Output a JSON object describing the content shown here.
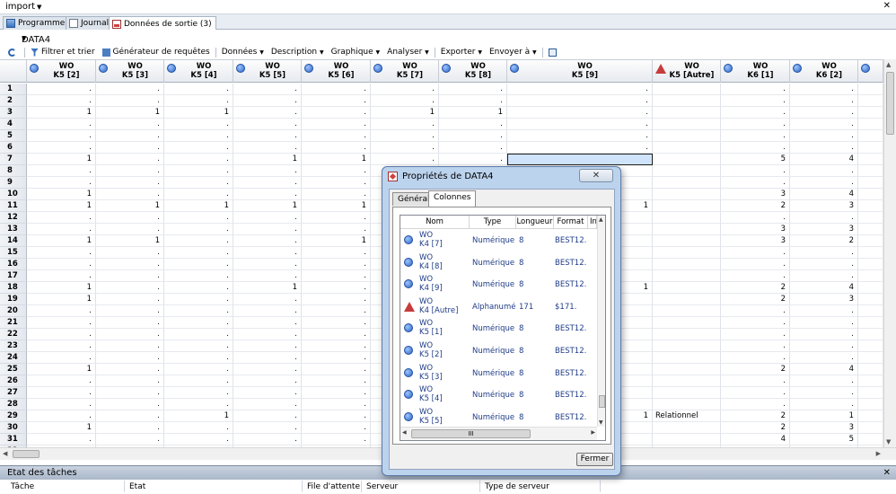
{
  "window": {
    "title": "import"
  },
  "tabs": [
    {
      "label": "Programme"
    },
    {
      "label": "Journal"
    },
    {
      "label": "Données de sortie (3)"
    }
  ],
  "dataset": {
    "name": "DATA4"
  },
  "toolbar": {
    "filter": "Filtrer et trier",
    "query": "Générateur de requêtes",
    "data": "Données",
    "description": "Description",
    "graph": "Graphique",
    "analyze": "Analyser",
    "export": "Exporter",
    "send": "Envoyer à"
  },
  "grid": {
    "columns": [
      {
        "l1": "WO",
        "l2": "K5 [2]",
        "type": "num"
      },
      {
        "l1": "WO",
        "l2": "K5 [3]",
        "type": "num"
      },
      {
        "l1": "WO",
        "l2": "K5 [4]",
        "type": "num"
      },
      {
        "l1": "WO",
        "l2": "K5 [5]",
        "type": "num"
      },
      {
        "l1": "WO",
        "l2": "K5 [6]",
        "type": "num"
      },
      {
        "l1": "WO",
        "l2": "K5 [7]",
        "type": "num"
      },
      {
        "l1": "WO",
        "l2": "K5 [8]",
        "type": "num"
      },
      {
        "l1": "WO",
        "l2": "K5 [9]",
        "type": "num"
      },
      {
        "l1": "WO",
        "l2": "K5 [Autre]",
        "type": "char"
      },
      {
        "l1": "WO",
        "l2": "K6 [1]",
        "type": "num"
      },
      {
        "l1": "WO",
        "l2": "K6 [2]",
        "type": "num"
      },
      {
        "l1": "",
        "l2": "",
        "type": "num"
      }
    ],
    "rows": [
      {
        "n": "1",
        "v": [
          ".",
          ".",
          ".",
          ".",
          ".",
          ".",
          ".",
          ".",
          "",
          ".",
          ".",
          ""
        ]
      },
      {
        "n": "2",
        "v": [
          ".",
          ".",
          ".",
          ".",
          ".",
          ".",
          ".",
          ".",
          "",
          ".",
          ".",
          ""
        ]
      },
      {
        "n": "3",
        "v": [
          "1",
          "1",
          "1",
          ".",
          ".",
          "1",
          "1",
          ".",
          "",
          ".",
          ".",
          ""
        ]
      },
      {
        "n": "4",
        "v": [
          ".",
          ".",
          ".",
          ".",
          ".",
          ".",
          ".",
          ".",
          "",
          ".",
          ".",
          ""
        ]
      },
      {
        "n": "5",
        "v": [
          ".",
          ".",
          ".",
          ".",
          ".",
          ".",
          ".",
          ".",
          "",
          ".",
          ".",
          ""
        ]
      },
      {
        "n": "6",
        "v": [
          ".",
          ".",
          ".",
          ".",
          ".",
          ".",
          ".",
          ".",
          "",
          ".",
          ".",
          ""
        ]
      },
      {
        "n": "7",
        "v": [
          "1",
          ".",
          ".",
          "1",
          "1",
          ".",
          ".",
          "",
          "",
          "5",
          "4",
          ""
        ]
      },
      {
        "n": "8",
        "v": [
          ".",
          ".",
          ".",
          ".",
          ".",
          "",
          "",
          "",
          "",
          ".",
          ".",
          ""
        ]
      },
      {
        "n": "9",
        "v": [
          ".",
          ".",
          ".",
          ".",
          ".",
          "",
          "",
          "",
          "",
          ".",
          ".",
          ""
        ]
      },
      {
        "n": "10",
        "v": [
          "1",
          ".",
          ".",
          ".",
          ".",
          "",
          "",
          "",
          "",
          "3",
          "4",
          ""
        ]
      },
      {
        "n": "11",
        "v": [
          "1",
          "1",
          "1",
          "1",
          "1",
          "",
          "",
          "1",
          "",
          "2",
          "3",
          ""
        ]
      },
      {
        "n": "12",
        "v": [
          ".",
          ".",
          ".",
          ".",
          ".",
          "",
          "",
          "",
          "",
          ".",
          ".",
          ""
        ]
      },
      {
        "n": "13",
        "v": [
          ".",
          ".",
          ".",
          ".",
          ".",
          "",
          "",
          "",
          "",
          "3",
          "3",
          ""
        ]
      },
      {
        "n": "14",
        "v": [
          "1",
          "1",
          ".",
          ".",
          "1",
          "",
          "",
          "",
          "",
          "3",
          "2",
          ""
        ]
      },
      {
        "n": "15",
        "v": [
          ".",
          ".",
          ".",
          ".",
          ".",
          "",
          "",
          "",
          "",
          ".",
          ".",
          ""
        ]
      },
      {
        "n": "16",
        "v": [
          ".",
          ".",
          ".",
          ".",
          ".",
          "",
          "",
          "",
          "",
          ".",
          ".",
          ""
        ]
      },
      {
        "n": "17",
        "v": [
          ".",
          ".",
          ".",
          ".",
          ".",
          "",
          "",
          "",
          "",
          ".",
          ".",
          ""
        ]
      },
      {
        "n": "18",
        "v": [
          "1",
          ".",
          ".",
          "1",
          ".",
          "",
          "",
          "1",
          "",
          "2",
          "4",
          ""
        ]
      },
      {
        "n": "19",
        "v": [
          "1",
          ".",
          ".",
          ".",
          ".",
          "",
          "",
          "",
          "",
          "2",
          "3",
          ""
        ]
      },
      {
        "n": "20",
        "v": [
          ".",
          ".",
          ".",
          ".",
          ".",
          "",
          "",
          "",
          "",
          ".",
          ".",
          ""
        ]
      },
      {
        "n": "21",
        "v": [
          ".",
          ".",
          ".",
          ".",
          ".",
          "",
          "",
          "",
          "",
          ".",
          ".",
          ""
        ]
      },
      {
        "n": "22",
        "v": [
          ".",
          ".",
          ".",
          ".",
          ".",
          "",
          "",
          "",
          "",
          ".",
          ".",
          ""
        ]
      },
      {
        "n": "23",
        "v": [
          ".",
          ".",
          ".",
          ".",
          ".",
          "",
          "",
          "",
          "",
          ".",
          ".",
          ""
        ]
      },
      {
        "n": "24",
        "v": [
          ".",
          ".",
          ".",
          ".",
          ".",
          "",
          "",
          "",
          "",
          ".",
          ".",
          ""
        ]
      },
      {
        "n": "25",
        "v": [
          "1",
          ".",
          ".",
          ".",
          ".",
          "",
          "",
          "",
          "",
          "2",
          "4",
          ""
        ]
      },
      {
        "n": "26",
        "v": [
          ".",
          ".",
          ".",
          ".",
          ".",
          "",
          "",
          "",
          "",
          ".",
          ".",
          ""
        ]
      },
      {
        "n": "27",
        "v": [
          ".",
          ".",
          ".",
          ".",
          ".",
          "",
          "",
          "",
          "",
          ".",
          ".",
          ""
        ]
      },
      {
        "n": "28",
        "v": [
          ".",
          ".",
          ".",
          ".",
          ".",
          "",
          "",
          "",
          "",
          ".",
          ".",
          ""
        ]
      },
      {
        "n": "29",
        "v": [
          ".",
          ".",
          "1",
          ".",
          ".",
          "",
          "",
          "1",
          "Relationnel",
          "2",
          "1",
          ""
        ]
      },
      {
        "n": "30",
        "v": [
          "1",
          ".",
          ".",
          ".",
          ".",
          "",
          "",
          "",
          "",
          "2",
          "3",
          ""
        ]
      },
      {
        "n": "31",
        "v": [
          ".",
          ".",
          ".",
          ".",
          ".",
          "",
          "",
          "",
          "",
          "4",
          "5",
          ""
        ]
      },
      {
        "n": "32",
        "v": [
          ".",
          ".",
          ".",
          ".",
          ".",
          "",
          "",
          "",
          "",
          ".",
          ".",
          ""
        ]
      }
    ]
  },
  "task_panel": {
    "title": "Etat des tâches",
    "columns": [
      "Tâche",
      "Etat",
      "File d'attente",
      "Serveur",
      "Type de serveur"
    ]
  },
  "dialog": {
    "title": "Propriétés de DATA4",
    "tabs": [
      "Général",
      "Colonnes"
    ],
    "list_headers": [
      "Nom",
      "Type",
      "Longueur",
      "Format",
      "In"
    ],
    "rows": [
      {
        "n1": "WO",
        "n2": "K4 [7]",
        "type": "Numérique",
        "len": "8",
        "fmt": "BEST12.",
        "kind": "num"
      },
      {
        "n1": "WO",
        "n2": "K4 [8]",
        "type": "Numérique",
        "len": "8",
        "fmt": "BEST12.",
        "kind": "num"
      },
      {
        "n1": "WO",
        "n2": "K4 [9]",
        "type": "Numérique",
        "len": "8",
        "fmt": "BEST12.",
        "kind": "num"
      },
      {
        "n1": "WO",
        "n2": "K4 [Autre]",
        "type": "Alphanumé",
        "len": "171",
        "fmt": "$171.",
        "kind": "char"
      },
      {
        "n1": "WO",
        "n2": "K5 [1]",
        "type": "Numérique",
        "len": "8",
        "fmt": "BEST12.",
        "kind": "num"
      },
      {
        "n1": "WO",
        "n2": "K5 [2]",
        "type": "Numérique",
        "len": "8",
        "fmt": "BEST12.",
        "kind": "num"
      },
      {
        "n1": "WO",
        "n2": "K5 [3]",
        "type": "Numérique",
        "len": "8",
        "fmt": "BEST12.",
        "kind": "num"
      },
      {
        "n1": "WO",
        "n2": "K5 [4]",
        "type": "Numérique",
        "len": "8",
        "fmt": "BEST12.",
        "kind": "num"
      },
      {
        "n1": "WO",
        "n2": "K5 [5]",
        "type": "Numérique",
        "len": "8",
        "fmt": "BEST12.",
        "kind": "num"
      }
    ],
    "close_button": "Fermer"
  }
}
